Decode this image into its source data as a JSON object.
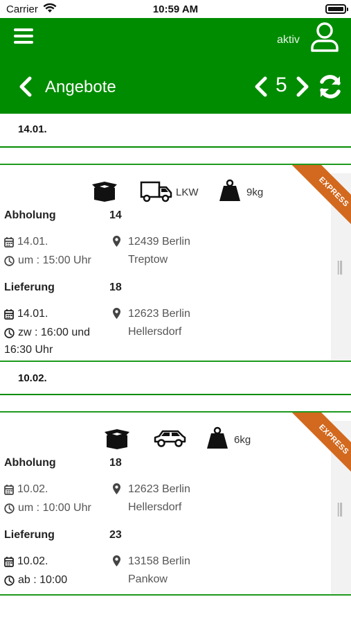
{
  "status_bar": {
    "carrier": "Carrier",
    "time": "10:59 AM"
  },
  "app_bar": {
    "status_label": "aktiv",
    "title": "Angebote",
    "page_count": "5"
  },
  "groups": [
    {
      "date": "14.01.",
      "card": {
        "badge": "EXPRESS",
        "vehicle_label": "LKW",
        "weight": "9kg",
        "pickup": {
          "label": "Abholung",
          "number": "14",
          "date": "14.01.",
          "time": "um : 15:00 Uhr",
          "address_line1": "12439 Berlin",
          "address_line2": "Treptow"
        },
        "delivery": {
          "label": "Lieferung",
          "number": "18",
          "date": "14.01.",
          "time_line1": "zw : 16:00 und",
          "time_line2": "16:30 Uhr",
          "address_line1": "12623 Berlin",
          "address_line2": "Hellersdorf"
        }
      }
    },
    {
      "date": "10.02.",
      "card": {
        "badge": "EXPRESS",
        "vehicle_label": "",
        "weight": "6kg",
        "pickup": {
          "label": "Abholung",
          "number": "18",
          "date": "10.02.",
          "time": "um : 10:00 Uhr",
          "address_line1": "12623 Berlin",
          "address_line2": "Hellersdorf"
        },
        "delivery": {
          "label": "Lieferung",
          "number": "23",
          "date": "10.02.",
          "time_line1": "ab : 10:00",
          "time_line2": "",
          "address_line1": "13158 Berlin",
          "address_line2": "Pankow"
        }
      }
    }
  ],
  "colors": {
    "primary_green": "#008c00",
    "express_orange": "#d2691e"
  },
  "icons": [
    "menu-icon",
    "user-icon",
    "back-icon",
    "prev-icon",
    "next-icon",
    "refresh-icon",
    "box-icon",
    "truck-icon",
    "car-icon",
    "weight-icon",
    "calendar-icon",
    "clock-icon",
    "location-pin-icon"
  ]
}
